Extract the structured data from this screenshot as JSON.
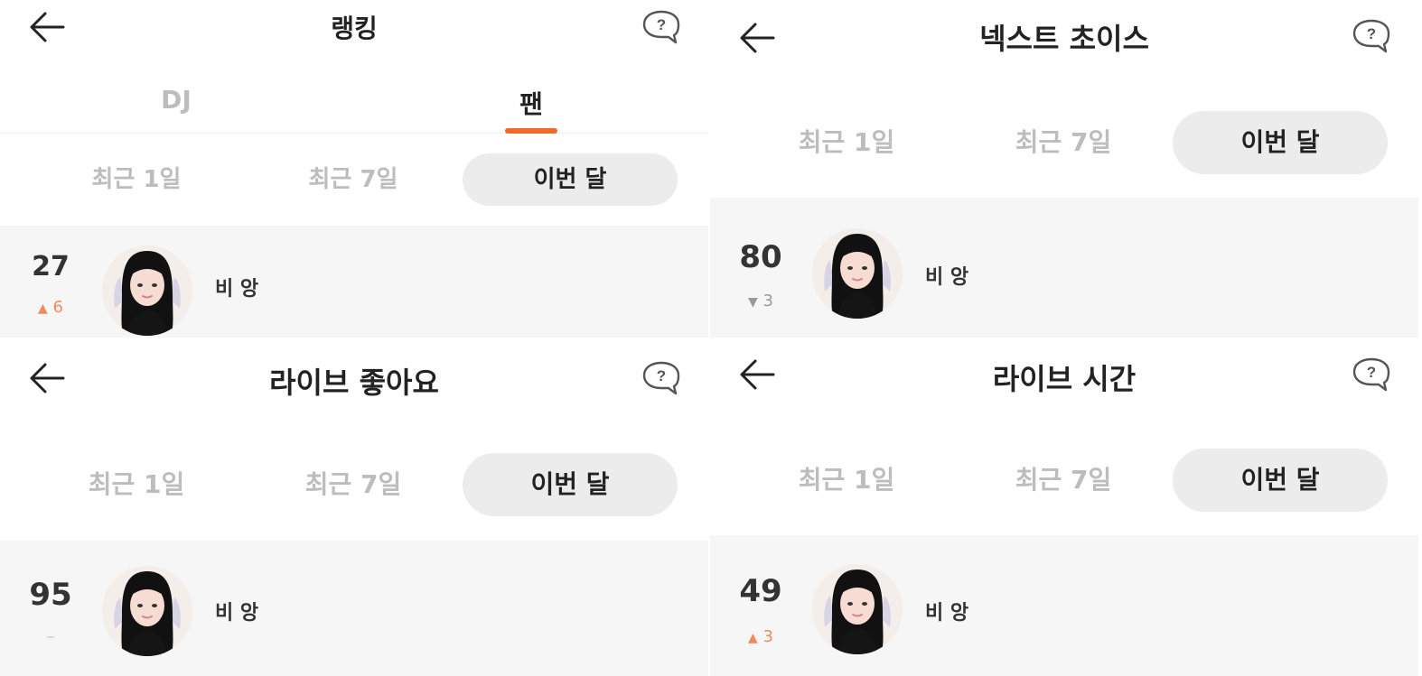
{
  "colors": {
    "accent": "#f06a2a",
    "up": "#ef8a5c",
    "down": "#9a9a9a",
    "selected_bg": "#ececec",
    "row_bg": "#f6f6f6"
  },
  "panels": [
    {
      "title": "랭킹",
      "tabs": [
        {
          "label": "DJ",
          "active": false
        },
        {
          "label": "팬",
          "active": true
        }
      ],
      "periods": [
        "최근 1일",
        "최근 7일",
        "이번 달"
      ],
      "selected_period": "이번 달",
      "entry": {
        "rank": "27",
        "change_icon": "triangle-up-icon",
        "change_glyph": "▲",
        "change": "6",
        "name": "비 앙"
      }
    },
    {
      "title": "넥스트 초이스",
      "periods": [
        "최근 1일",
        "최근 7일",
        "이번 달"
      ],
      "selected_period": "이번 달",
      "entry": {
        "rank": "80",
        "change_icon": "triangle-down-icon",
        "change_glyph": "▼",
        "change": "3",
        "name": "비 앙"
      }
    },
    {
      "title": "라이브 좋아요",
      "periods": [
        "최근 1일",
        "최근 7일",
        "이번 달"
      ],
      "selected_period": "이번 달",
      "entry": {
        "rank": "95",
        "change_icon": "dash-icon",
        "change_glyph": "–",
        "change": "",
        "name": "비 앙"
      }
    },
    {
      "title": "라이브 시간",
      "periods": [
        "최근 1일",
        "최근 7일",
        "이번 달"
      ],
      "selected_period": "이번 달",
      "entry": {
        "rank": "49",
        "change_icon": "triangle-up-icon",
        "change_glyph": "▲",
        "change": "3",
        "name": "비 앙"
      }
    }
  ],
  "icons": {
    "back": "back-arrow-icon",
    "help": "help-bubble-icon",
    "avatar": "user-avatar"
  }
}
